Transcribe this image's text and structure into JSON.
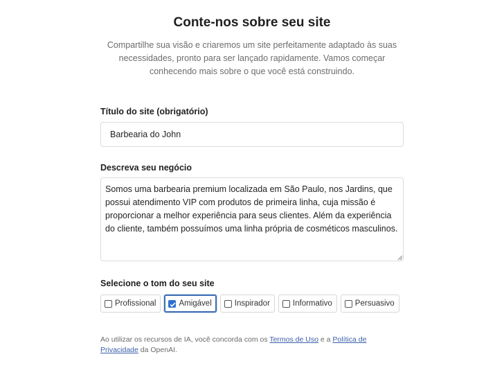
{
  "header": {
    "title": "Conte-nos sobre seu site",
    "subtitle": "Compartilhe sua visão e criaremos um site perfeitamente adaptado às suas necessidades, pronto para ser lançado rapidamente. Vamos começar conhecendo mais sobre o que você está construindo."
  },
  "site_title": {
    "label": "Título do site (obrigatório)",
    "value": "Barbearia do John"
  },
  "business": {
    "label": "Descreva seu negócio",
    "value": "Somos uma barbearia premium localizada em São Paulo, nos Jardins, que possui atendimento VIP com produtos de primeira linha, cuja missão é proporcionar a melhor experiência para seus clientes. Além da experiência do cliente, também possuímos uma linha própria de cosméticos masculinos."
  },
  "tone": {
    "label": "Selecione o tom do seu site",
    "options": [
      {
        "label": "Profissional",
        "checked": false
      },
      {
        "label": "Amigável",
        "checked": true
      },
      {
        "label": "Inspirador",
        "checked": false
      },
      {
        "label": "Informativo",
        "checked": false
      },
      {
        "label": "Persuasivo",
        "checked": false
      }
    ]
  },
  "disclaimer": {
    "prefix": "Ao utilizar os recursos de IA, você concorda com os ",
    "terms_link": "Termos de Uso",
    "middle": " e a ",
    "privacy_link": "Política de Privacidade",
    "suffix": " da OpenAI."
  },
  "colors": {
    "accent": "#2f6fd0",
    "link": "#3a5fa8",
    "muted_text": "#6c6c6c"
  }
}
